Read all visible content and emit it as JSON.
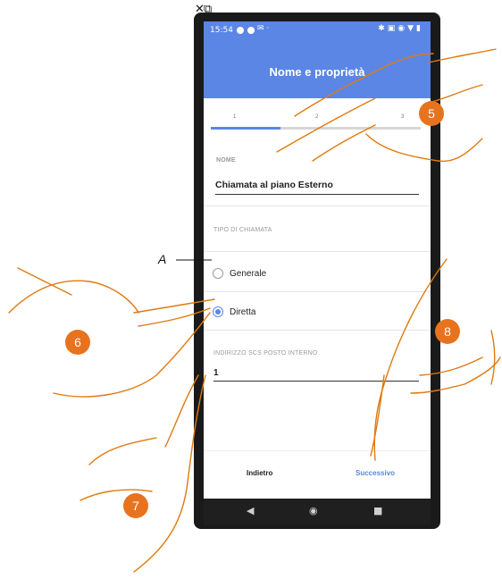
{
  "status_bar": {
    "time": "15:54"
  },
  "header": {
    "title": "Nome e proprietà"
  },
  "stepper": {
    "steps": [
      "1",
      "2",
      "3"
    ],
    "current_step": 1,
    "progress": 0.33
  },
  "name_field": {
    "label": "NOME",
    "value": "Chiamata al piano Esterno"
  },
  "call_type": {
    "label": "TIPO DI CHIAMATA",
    "options": [
      {
        "label": "Generale",
        "selected": false
      },
      {
        "label": "Diretta",
        "selected": true
      }
    ]
  },
  "address_field": {
    "label": "INDIRIZZO SCS POSTO INTERNO",
    "value": "1"
  },
  "footer": {
    "back_label": "Indietro",
    "next_label": "Successivo"
  },
  "callouts": {
    "c5": "5",
    "c6": "6",
    "c7": "7",
    "c8": "8",
    "a": "A"
  },
  "colors": {
    "accent": "#5b86e5",
    "callout": "#e8731e",
    "hand_line": "#e07a10"
  },
  "icons": [
    "close-icon",
    "external-link-icon",
    "back-triangle-icon",
    "home-circle-icon",
    "recents-square-icon"
  ]
}
